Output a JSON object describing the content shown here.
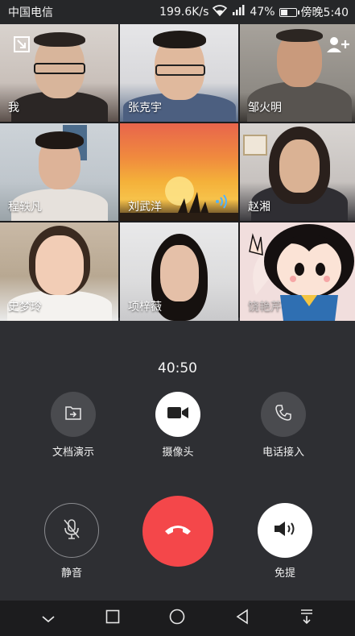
{
  "status_bar": {
    "carrier": "中国电信",
    "speed": "199.6K/s",
    "battery": "47%",
    "battery_level": 0.47,
    "time": "傍晚5:40"
  },
  "participants": [
    {
      "name": "我"
    },
    {
      "name": "张克宇"
    },
    {
      "name": "邹火明"
    },
    {
      "name": "程轶凡"
    },
    {
      "name": "刘武洋"
    },
    {
      "name": "赵湘"
    },
    {
      "name": "史梦玲"
    },
    {
      "name": "项梓薇"
    },
    {
      "name": "饶艳芹"
    }
  ],
  "call": {
    "timer": "40:50",
    "share_doc_label": "文档演示",
    "camera_label": "摄像头",
    "phone_join_label": "电话接入",
    "mute_label": "静音",
    "speaker_label": "免提"
  },
  "colors": {
    "hangup": "#f4474a",
    "speaking": "#4fb3ff"
  }
}
